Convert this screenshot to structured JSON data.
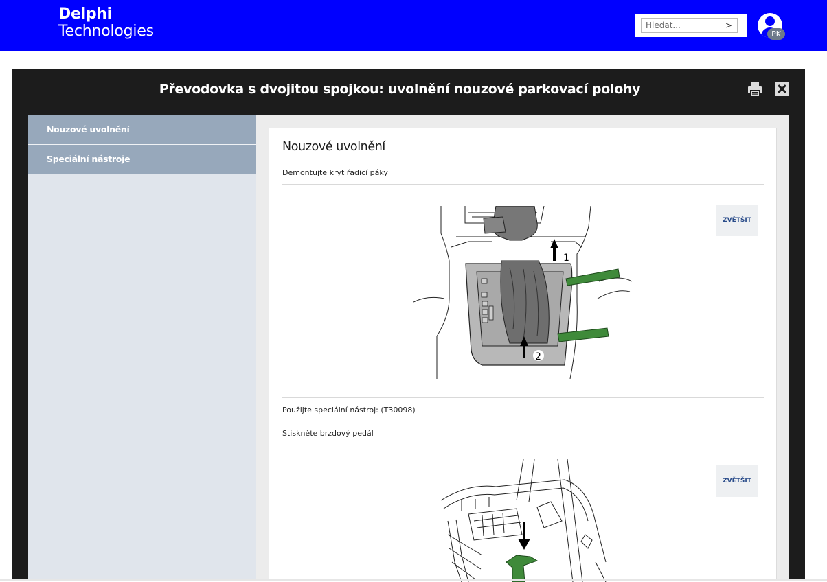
{
  "header": {
    "brand_line1": "Delphi",
    "brand_line2": "Technologies",
    "search_placeholder": "Hledat...",
    "search_go": ">",
    "user_initials": "PK",
    "brand_color": "#0000ff"
  },
  "modal": {
    "title": "Převodovka s dvojitou spojkou: uvolnění nouzové parkovací polohy",
    "print_icon": "printer-icon",
    "close_icon": "close-icon"
  },
  "sidebar": {
    "items": [
      {
        "label": "Nouzové uvolnění"
      },
      {
        "label": "Speciální nástroje"
      }
    ]
  },
  "content": {
    "heading": "Nouzové uvolnění",
    "steps": [
      "Demontujte kryt řadicí páky",
      "Použijte speciální nástroj: (T30098)",
      "Stiskněte brzdový pedál"
    ],
    "zoom_label": "ZVĚTŠIT",
    "figure1_labels": [
      "1",
      "2"
    ]
  }
}
